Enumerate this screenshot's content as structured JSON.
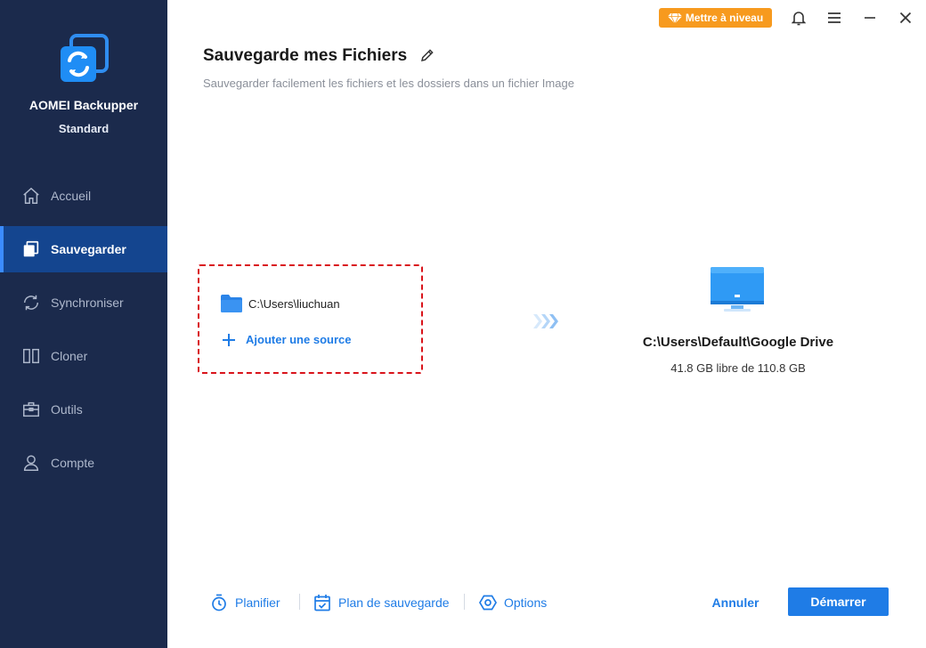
{
  "app": {
    "name": "AOMEI Backupper",
    "edition": "Standard",
    "logo_icon": "sync-arrows-logo"
  },
  "sidebar": {
    "items": [
      {
        "label": "Accueil",
        "icon": "home-icon",
        "active": false
      },
      {
        "label": "Sauvegarder",
        "icon": "backup-icon",
        "active": true
      },
      {
        "label": "Synchroniser",
        "icon": "sync-icon",
        "active": false
      },
      {
        "label": "Cloner",
        "icon": "clone-icon",
        "active": false
      },
      {
        "label": "Outils",
        "icon": "toolbox-icon",
        "active": false
      },
      {
        "label": "Compte",
        "icon": "user-icon",
        "active": false
      }
    ]
  },
  "topbar": {
    "upgrade_label": "Mettre à niveau",
    "icons": [
      "bell-icon",
      "menu-icon",
      "minimize-icon",
      "close-icon"
    ]
  },
  "header": {
    "title": "Sauvegarde mes Fichiers",
    "subtitle": "Sauvegarder facilement les fichiers et les dossiers dans un fichier Image"
  },
  "source": {
    "path": "C:\\Users\\liuchuan",
    "add_label": "Ajouter une source"
  },
  "destination": {
    "path": "C:\\Users\\Default\\Google Drive",
    "space": "41.8 GB libre de 110.8 GB"
  },
  "footer": {
    "schedule_label": "Planifier",
    "scheme_label": "Plan de sauvegarde",
    "options_label": "Options",
    "cancel_label": "Annuler",
    "start_label": "Démarrer"
  },
  "colors": {
    "sidebar_bg": "#1b2a4c",
    "sidebar_active": "#14458f",
    "accent": "#1f7ce6",
    "upgrade": "#f79a1e",
    "source_border": "#d9141b"
  }
}
